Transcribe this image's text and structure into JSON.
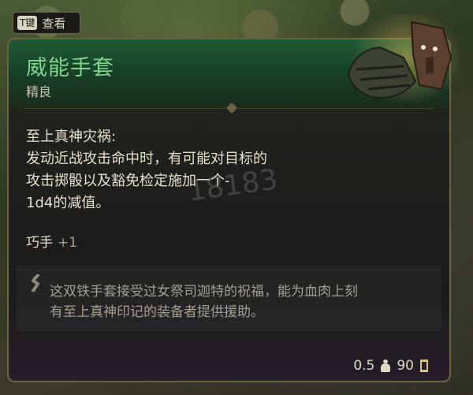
{
  "keyhint": {
    "key": "T键",
    "label": "查看"
  },
  "item": {
    "name": "威能手套",
    "rarity": "精良",
    "effect_title": "至上真神灾祸:",
    "effect_lines": [
      "发动近战攻击命中时，有可能对目标的",
      "攻击掷骰以及豁免检定施加一个-",
      "1d4的减值。"
    ],
    "bonus_label": "巧手",
    "bonus_value": "+1",
    "lore_lines": [
      "这双铁手套接受过女祭司迦特的祝福，能为血肉上刻",
      "有至上真神印记的装备者提供援助。"
    ],
    "weight": "0.5",
    "price": "90"
  },
  "watermark": "18183",
  "colors": {
    "title": "#7fd48d",
    "header": "#1f5a36",
    "border": "#6b6243"
  },
  "icons": {
    "weight": "weight-icon",
    "price": "coin-icon",
    "lore": "lore-quote-icon"
  }
}
